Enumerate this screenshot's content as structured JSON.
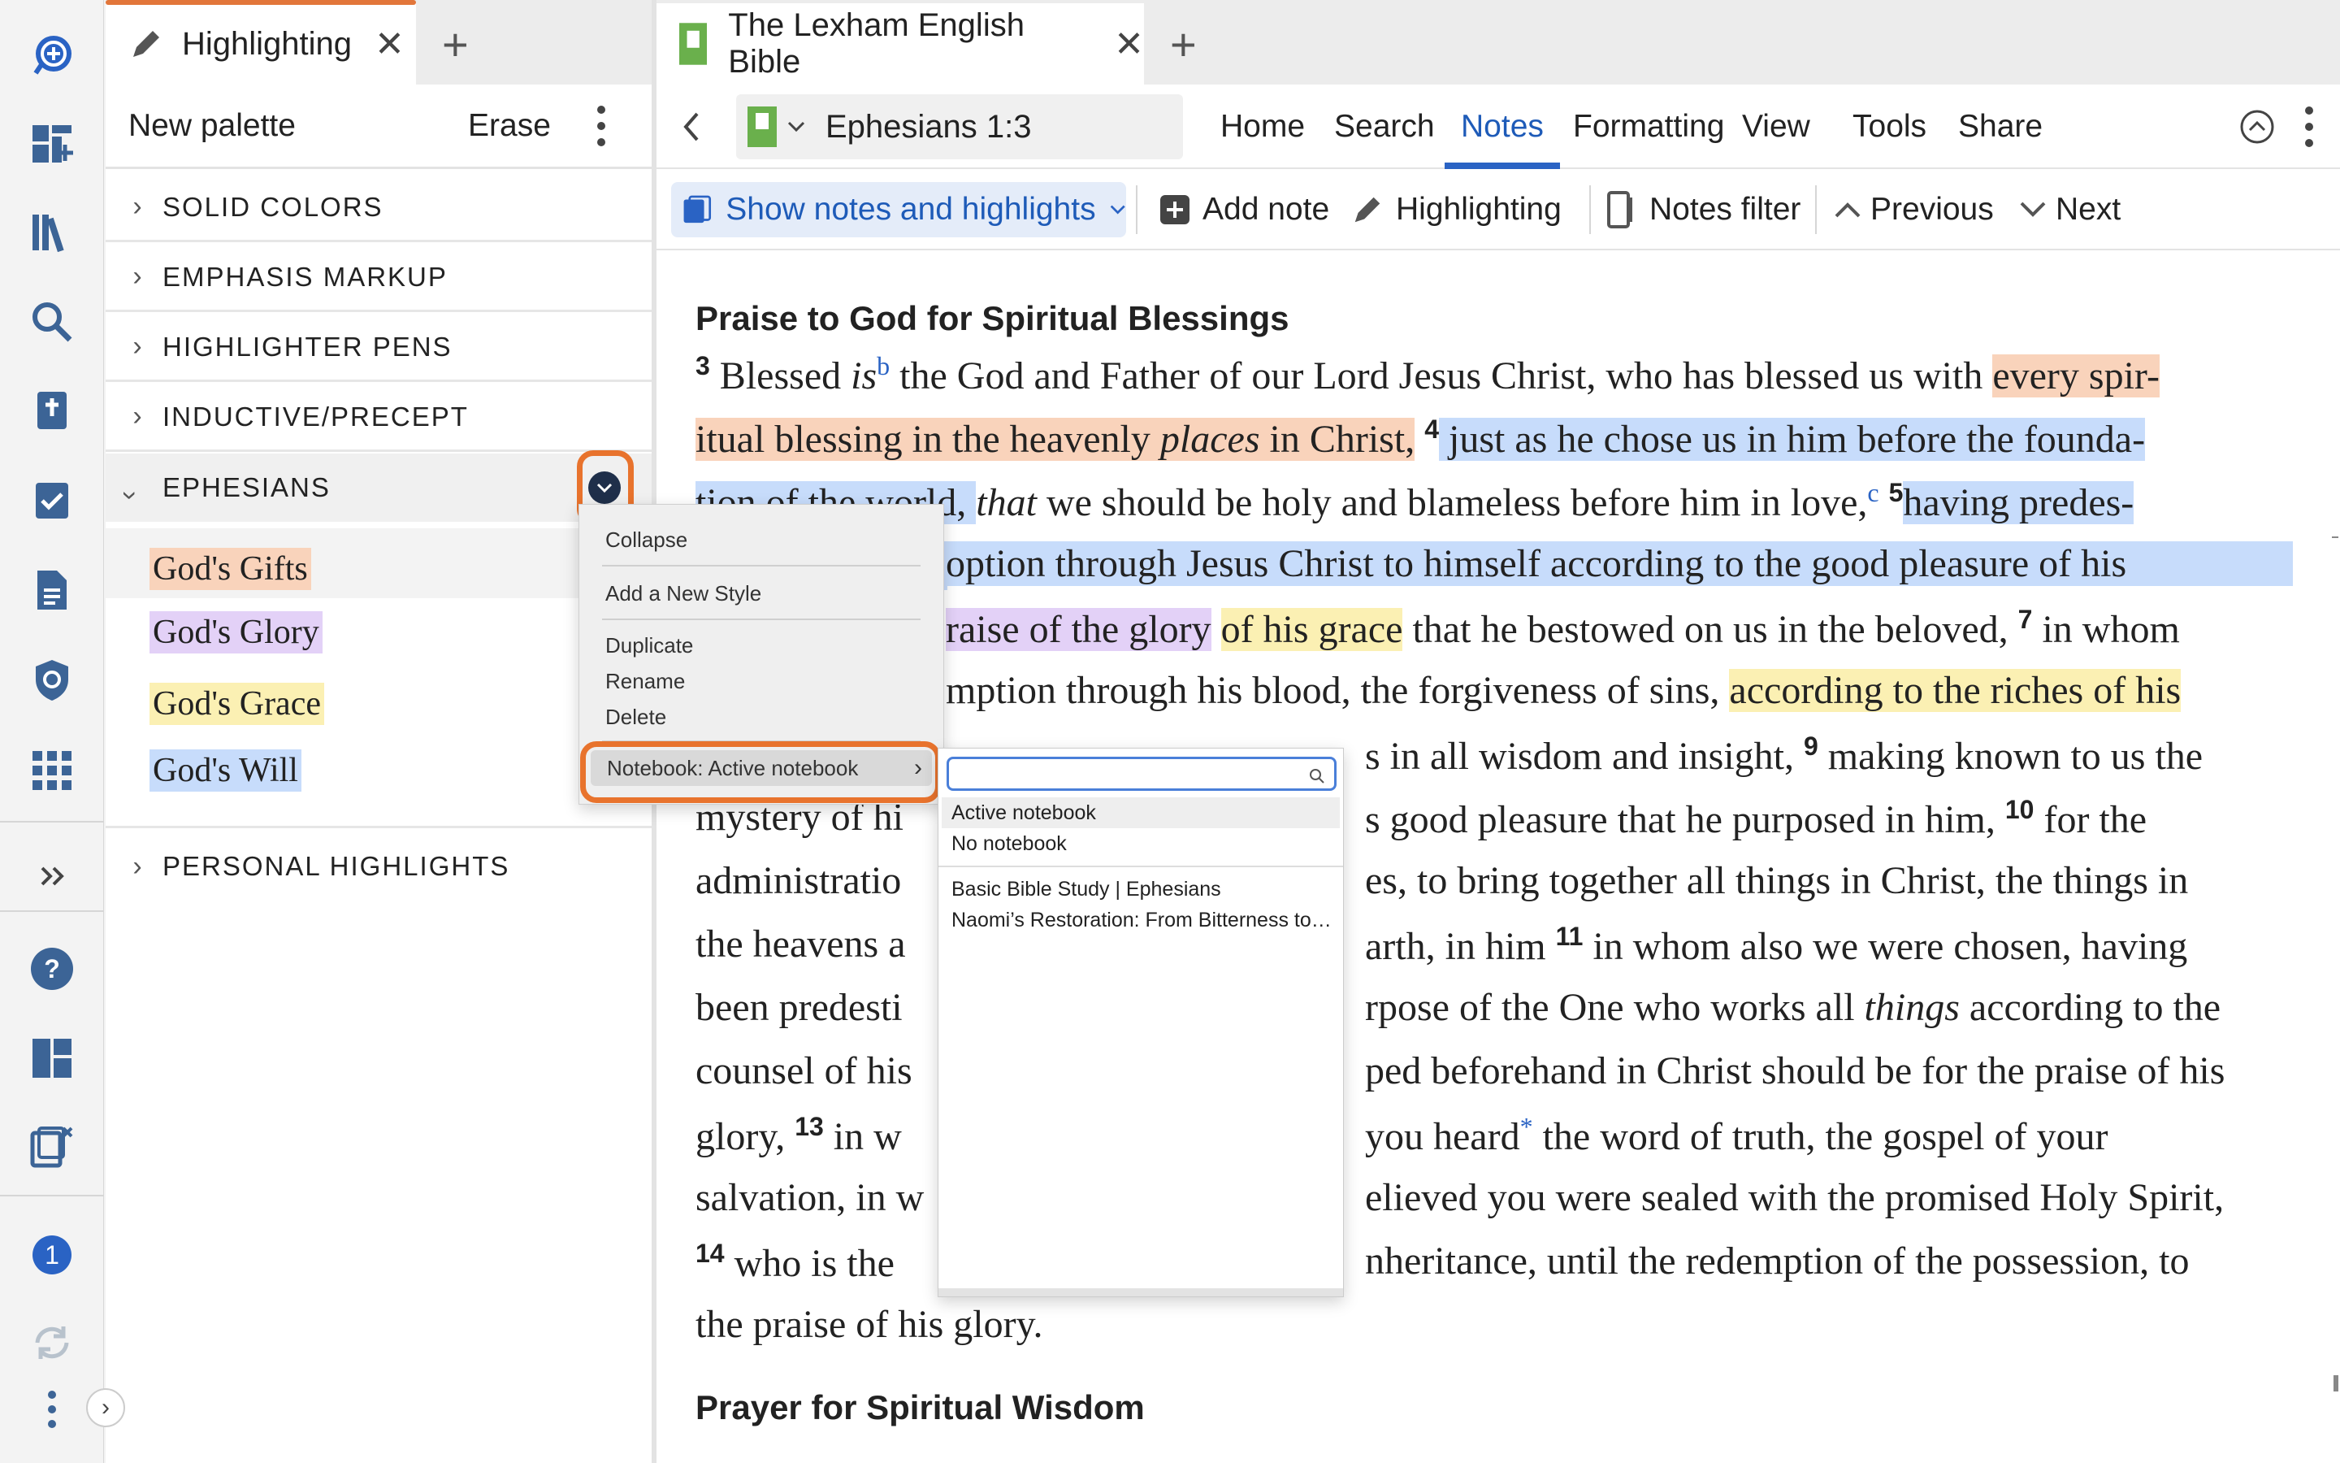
{
  "left_panel": {
    "tab": {
      "label": "Highlighting"
    },
    "toolbar": {
      "new_palette": "New palette",
      "erase": "Erase"
    },
    "sections": [
      {
        "label": "SOLID COLORS",
        "expanded": false
      },
      {
        "label": "EMPHASIS MARKUP",
        "expanded": false
      },
      {
        "label": "HIGHLIGHTER PENS",
        "expanded": false
      },
      {
        "label": "INDUCTIVE/PRECEPT",
        "expanded": false
      },
      {
        "label": "EPHESIANS",
        "expanded": true
      },
      {
        "label": "PERSONAL HIGHLIGHTS",
        "expanded": false
      }
    ],
    "styles": [
      {
        "label": "God's Gifts",
        "color": "#f9d3bb"
      },
      {
        "label": "God's Glory",
        "color": "#e3d1f7"
      },
      {
        "label": "God's Grace",
        "color": "#fbf0b3"
      },
      {
        "label": "God's Will",
        "color": "#c7dcfb"
      }
    ]
  },
  "context_menu": {
    "items": [
      "Collapse",
      "Add a New Style",
      "Duplicate",
      "Rename",
      "Delete"
    ],
    "submenu_label": "Notebook: Active notebook"
  },
  "notebook_menu": {
    "search_placeholder": "",
    "options": [
      "Active notebook",
      "No notebook"
    ],
    "notebooks": [
      "Basic Bible Study | Ephesians",
      "Naomi’s Restoration: From Bitterness to…"
    ]
  },
  "right_panel": {
    "tab": {
      "label": "The Lexham English Bible"
    },
    "reference": "Ephesians 1:3",
    "menu": [
      "Home",
      "Search",
      "Notes",
      "Formatting",
      "View",
      "Tools",
      "Share"
    ],
    "active_menu": "Notes",
    "toolbar": {
      "show_notes": "Show notes and highlights",
      "add_note": "Add note",
      "highlighting": "Highlighting",
      "notes_filter": "Notes filter",
      "previous": "Previous",
      "next": "Next"
    },
    "heading1": "Praise to God for Spiritual Blessings",
    "heading2": "Prayer for Spiritual Wisdom",
    "verse_numbers": [
      "3",
      "4",
      "5",
      "7",
      "9",
      "10",
      "11",
      "13",
      "14"
    ],
    "footnote_markers": [
      "b",
      "c",
      "*"
    ],
    "lines": [
      [
        "Blessed ",
        "is",
        " the God and Father of our Lord Jesus Christ, who has blessed us with ",
        "every spir-"
      ],
      [
        "itual blessing in the heavenly ",
        "places",
        " in Christ,",
        " just as he chose us in him before the founda-"
      ],
      [
        "tion of the world, ",
        "that",
        " we should be holy and blameless before him in love,",
        "having predes-"
      ],
      [
        "",
        "option through Jesus Christ to himself according to the good pleasure of his"
      ],
      [
        "",
        "raise of the glory",
        "of his grace",
        " that he bestowed on us in the beloved, ",
        " in whom"
      ],
      [
        "",
        "mption through his blood, the forgiveness of sins, ",
        "according to the riches of his"
      ],
      [
        "",
        "s in all wisdom and insight, ",
        " making known to us the"
      ],
      [
        "mystery of hi",
        "s good pleasure that he purposed in him, ",
        " for the"
      ],
      [
        "administratio",
        "es, to bring together all things in Christ, the things in"
      ],
      [
        "the heavens a",
        "arth, in him ",
        " in whom also we were chosen, having"
      ],
      [
        "been predesti",
        "rpose of the One who works all ",
        "things",
        " according to the"
      ],
      [
        "counsel of his",
        "ped beforehand in Christ should be for the praise of his"
      ],
      [
        "glory, ",
        " in w",
        "you heard",
        " the word of truth, the gospel of your"
      ],
      [
        "salvation, in w",
        "elieved you were sealed with the promised Holy Spirit,"
      ],
      [
        " who is the ",
        "nheritance, until the redemption of the possession, to"
      ],
      [
        "the praise of his glory."
      ]
    ]
  },
  "rail": {
    "badge": "1"
  },
  "colors": {
    "accent": "#e8732d",
    "brand_blue": "#2a63c4",
    "highlight_orange": "#f9d3bb",
    "highlight_blue": "#c7dcfb",
    "highlight_purple": "#e3d1f7",
    "highlight_yellow": "#fbf0b3"
  }
}
